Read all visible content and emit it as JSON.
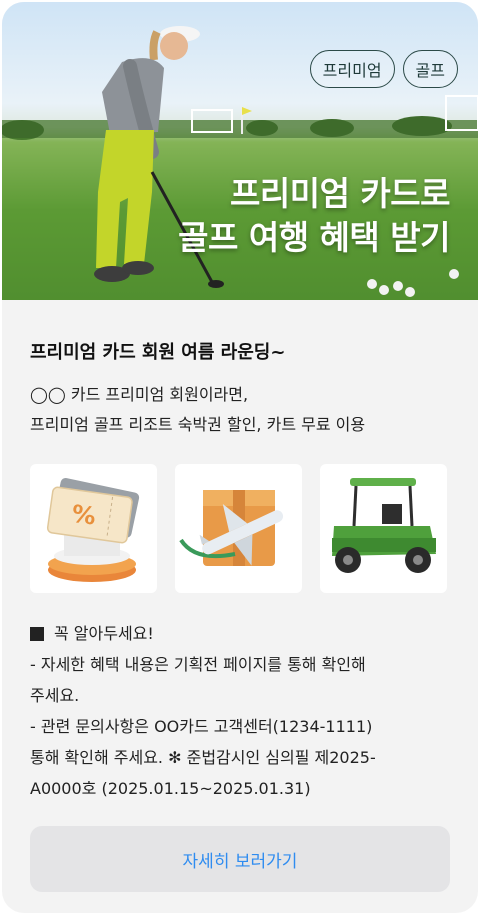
{
  "hero": {
    "chips": [
      "프리미엄",
      "골프"
    ],
    "title_line1": "프리미엄 카드로",
    "title_line2": "골프 여행 혜택 받기"
  },
  "content": {
    "headline": "프리미엄 카드 회원 여름 라운딩~",
    "desc_line1": "◯◯ 카드 프리미엄 회원이라면,",
    "desc_line2": "프리미엄 골프 리조트 숙박권 할인, 카트 무료 이용",
    "tiles": [
      {
        "icon": "discount-ticket-icon"
      },
      {
        "icon": "travel-package-icon"
      },
      {
        "icon": "golf-cart-icon"
      }
    ],
    "notice": {
      "title": "꼭 알아두세요!",
      "line1": "- 자세한 혜택 내용은 기획전 페이지를 통해 확인해",
      "line2": "주세요.",
      "line3": "- 관련 문의사항은 OO카드 고객센터(1234-1111)",
      "line4": "통해 확인해 주세요. ✻ 준법감시인 심의필 제2025-",
      "line5": "A0000호 (2025.01.15~2025.01.31)"
    },
    "cta_label": "자세히 보러가기"
  },
  "colors": {
    "accent": "#2f8cf0",
    "chip_border": "#2c4a48",
    "background": "#f3f3f3"
  }
}
